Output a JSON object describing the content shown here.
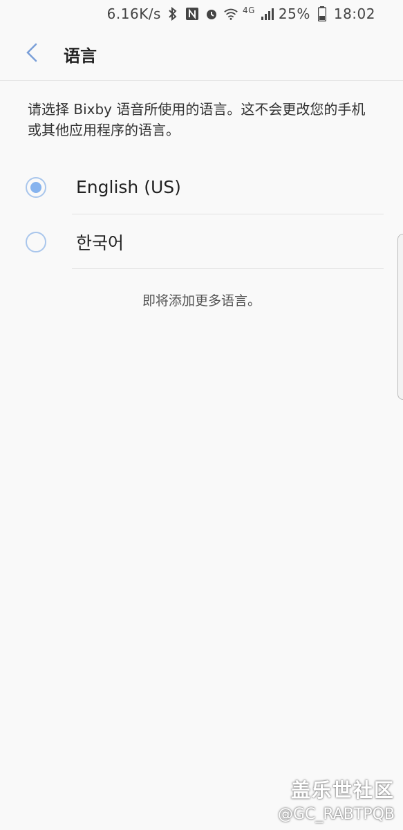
{
  "status_bar": {
    "network_speed": "6.16K/s",
    "network_type": "4G",
    "battery": "25%",
    "time": "18:02",
    "icons": [
      "bluetooth-icon",
      "nfc-icon",
      "alarm-icon",
      "wifi-icon",
      "signal-icon",
      "battery-icon"
    ]
  },
  "header": {
    "title": "语言",
    "back_icon": "chevron-left-icon"
  },
  "description": "请选择 Bixby 语音所使用的语言。这不会更改您的手机或其他应用程序的语言。",
  "options": [
    {
      "label": "English (US)",
      "selected": true
    },
    {
      "label": "한국어",
      "selected": false
    }
  ],
  "note": "即将添加更多语言。",
  "watermark": {
    "title": "盖乐世社区",
    "handle": "@GC_RABTPQB"
  },
  "colors": {
    "background": "#f9f9f9",
    "radio_border": "#a9c6ec",
    "radio_fill": "#86b3ee",
    "back_arrow": "#7a9fd8"
  }
}
